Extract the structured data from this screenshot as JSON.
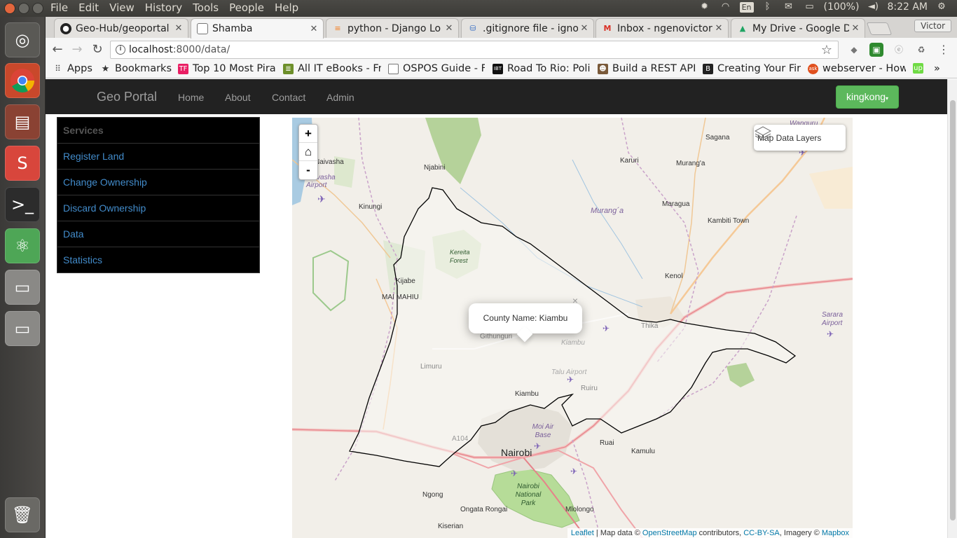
{
  "topbar": {
    "menu": [
      "File",
      "Edit",
      "View",
      "History",
      "Tools",
      "People",
      "Help"
    ],
    "lang": "En",
    "battery": "(100%)",
    "time": "8:22 AM"
  },
  "browser": {
    "tabs": [
      {
        "label": "Geo-Hub/geoportal",
        "icon": "github-icon"
      },
      {
        "label": "Shamba",
        "icon": "page-icon"
      },
      {
        "label": "python - Django Lo",
        "icon": "stackoverflow-icon"
      },
      {
        "label": ".gitignore file - igno",
        "icon": "database-icon"
      },
      {
        "label": "Inbox - ngenovictor",
        "icon": "gmail-icon"
      },
      {
        "label": "My Drive - Google D",
        "icon": "drive-icon"
      }
    ],
    "profile": "Victor",
    "url_host": "localhost",
    "url_path": ":8000/data/",
    "bookmarks": [
      {
        "label": "Apps",
        "icon": "apps-icon"
      },
      {
        "label": "Bookmarks",
        "icon": "star-icon"
      },
      {
        "label": "Top 10 Most Pira",
        "icon": "tf-icon"
      },
      {
        "label": "All IT eBooks - Fre",
        "icon": "books-icon"
      },
      {
        "label": "OSPOS Guide - Fr",
        "icon": "page-icon"
      },
      {
        "label": "Road To Rio: Polic",
        "icon": "ibt-icon"
      },
      {
        "label": "Build a REST API",
        "icon": "person-icon"
      },
      {
        "label": "Creating Your Fir",
        "icon": "b-icon"
      },
      {
        "label": "webserver - How",
        "icon": "ask-icon"
      }
    ],
    "more_bookmarks": "»"
  },
  "site": {
    "brand": "Geo Portal",
    "nav": [
      "Home",
      "About",
      "Contact",
      "Admin"
    ],
    "user": "kingkong"
  },
  "sidebar": {
    "header": "Services",
    "items": [
      "Register Land",
      "Change Ownership",
      "Discard Ownership",
      "Data",
      "Statistics"
    ]
  },
  "map": {
    "zoom_in": "+",
    "home": "⌂",
    "zoom_out": "-",
    "layers_label": "Map Data Layers",
    "popup_text": "County Name: Kiambu",
    "popup_close": "×",
    "places": {
      "naivasha": "Naivasha",
      "naivasha_airport": "Naivasha Airport",
      "njabini": "Njabini",
      "kinungi": "Kinungi",
      "kijabe": "Kijabe",
      "mai_mahiu": "MAI MAHIU",
      "kereita": "Kereita Forest",
      "githunguri": "Githunguri",
      "kiambu_label": "Kiambu",
      "limuru": "Limuru",
      "talu_airport": "Talu Airport",
      "ruiru": "Ruiru",
      "kiambu_town": "Kiambu",
      "moi_air_base": "Moi Air Base",
      "nairobi": "Nairobi",
      "ruai": "Ruai",
      "kamulu": "Kamulu",
      "ngong": "Ngong",
      "ongata_rongai": "Ongata Rongai",
      "nairobi_np": "Nairobi National Park",
      "mlolongo": "Mlolongo",
      "kiserian": "Kiserian",
      "sagana": "Sagana",
      "wanguru": "Wanguru",
      "karuri": "Karuri",
      "muranga": "Murang'a",
      "muranga_county": "Murang´a",
      "maragua": "Maragua",
      "kambiti": "Kambiti Town",
      "kenol": "Kenol",
      "thika": "Thika",
      "sarara": "Sarara Airport",
      "a104": "A104"
    },
    "attribution": {
      "leaflet": "Leaflet",
      "sep": " | Map data © ",
      "osm": "OpenStreetMap",
      "contrib": " contributors, ",
      "ccbysa": "CC-BY-SA",
      "imagery": ", Imagery © ",
      "mapbox": "Mapbox"
    }
  }
}
